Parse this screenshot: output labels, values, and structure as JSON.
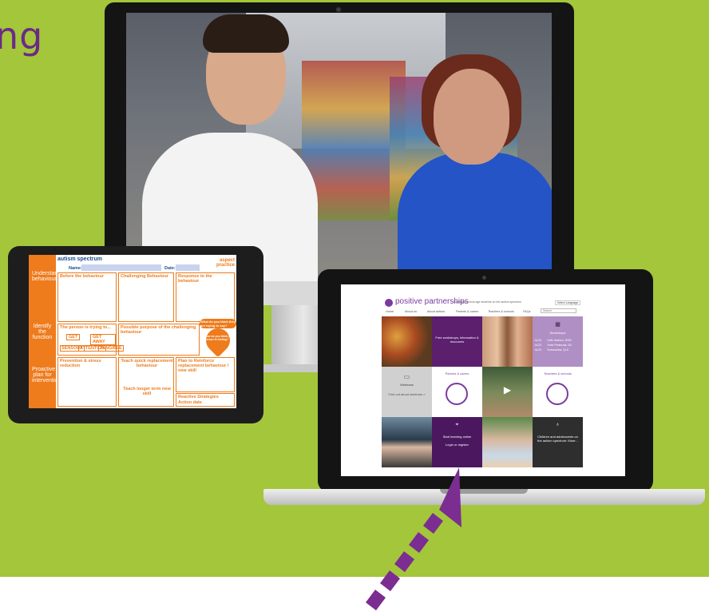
{
  "heading": {
    "text": "ng"
  },
  "colors": {
    "background": "#a3c63a",
    "purple": "#6b2a86",
    "orange": "#ee7b1c"
  },
  "worksheet": {
    "brand": "autism spectrum",
    "partner": "aspect practice",
    "name_label": "Name:",
    "date_label": "Date:",
    "sections": [
      "Understand behaviour",
      "Identify the function",
      "Proactive plan for intervention"
    ],
    "boxes": {
      "before": "Before the behaviour",
      "challenging": "Challenging Behaviour",
      "response": "Response to the behaviour",
      "trying": "The person is trying to...",
      "purpose": "Possible purpose of the challenging behaviour",
      "prevention": "Prevention & stress reduction",
      "teach": "Teach quick replacement behaviour",
      "reinforce": "Plan to Reinforce replacement behaviour / new skill",
      "reactive": "Reactive Strategies",
      "action": "Action date",
      "teach_longer": "Teach longer term new skill"
    },
    "options": [
      "GET",
      "GET AWAY",
      "SENSORY",
      "ATTENTION",
      "TANGIBLE"
    ],
    "heart": "How do you think the person is feeling?",
    "think": "What do you think they are trying to say?"
  },
  "site": {
    "logo": "positive partnerships",
    "tagline": "supporting school-age students on the autism spectrum",
    "language": "Select Language",
    "nav": [
      "Home",
      "About us",
      "About autism",
      "Parents & carers",
      "Teachers & schools",
      "FAQs"
    ],
    "search_placeholder": "Search",
    "tiles": {
      "workshops_title": "Workshops",
      "workshops_dates": [
        "Jul 23",
        "Jul 23",
        "Jul 23"
      ],
      "workshops_places": [
        "Coffs Harbour, NSW",
        "Yorke Peninsula, SA",
        "Toowoomba, QLD"
      ],
      "free_workshops": "Free workshops, information & resources",
      "webinars_title": "Webinars",
      "webinars_link": "Find out about webinars »",
      "parents": "Parents & carers",
      "teachers": "Teachers & schools",
      "start_learning": "Start learning online",
      "login": "Login or register",
      "intro": "Children and adolescents on the autism spectrum: More..."
    }
  }
}
